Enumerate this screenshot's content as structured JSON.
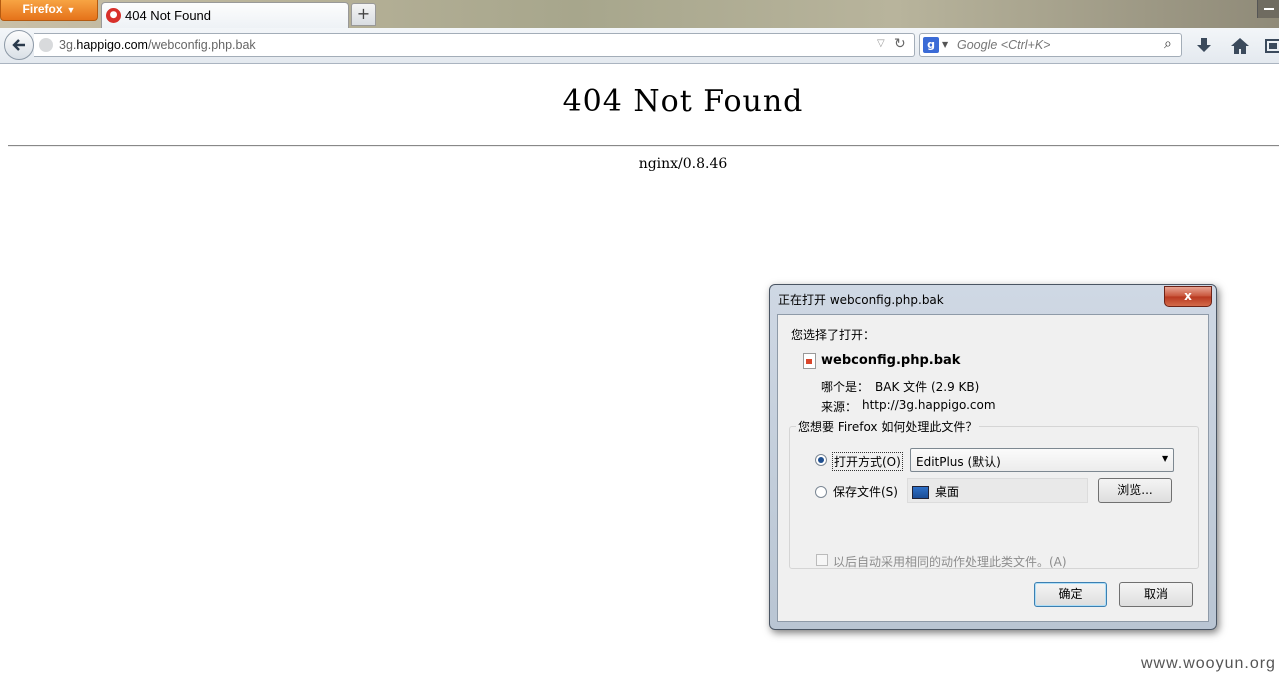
{
  "browser": {
    "menu_button_label": "Firefox",
    "tab_title": "404 Not Found",
    "new_tab_label": "+",
    "url_prefix": "3g.",
    "url_domain": "happigo.com",
    "url_path": "/webconfig.php.bak",
    "search_engine_icon": "g",
    "search_placeholder": "Google <Ctrl+K>"
  },
  "page": {
    "heading": "404 Not Found",
    "server": "nginx/0.8.46"
  },
  "dialog": {
    "title": "正在打开 webconfig.php.bak",
    "close_label": "x",
    "intro": "您选择了打开：",
    "filename": "webconfig.php.bak",
    "type_label": "哪个是：",
    "type_value": "BAK 文件 (2.9 KB)",
    "source_label": "来源：",
    "source_value": "http://3g.happigo.com",
    "question": "您想要 Firefox 如何处理此文件？",
    "open_with_label": "打开方式(O)",
    "open_with_app": "EditPlus (默认)",
    "save_file_label": "保存文件(S)",
    "save_location": "桌面",
    "browse_label": "浏览...",
    "auto_label": "以后自动采用相同的动作处理此类文件。(A)",
    "ok_label": "确定",
    "cancel_label": "取消",
    "selected_option": "open_with"
  },
  "watermark": "www.wooyun.org"
}
